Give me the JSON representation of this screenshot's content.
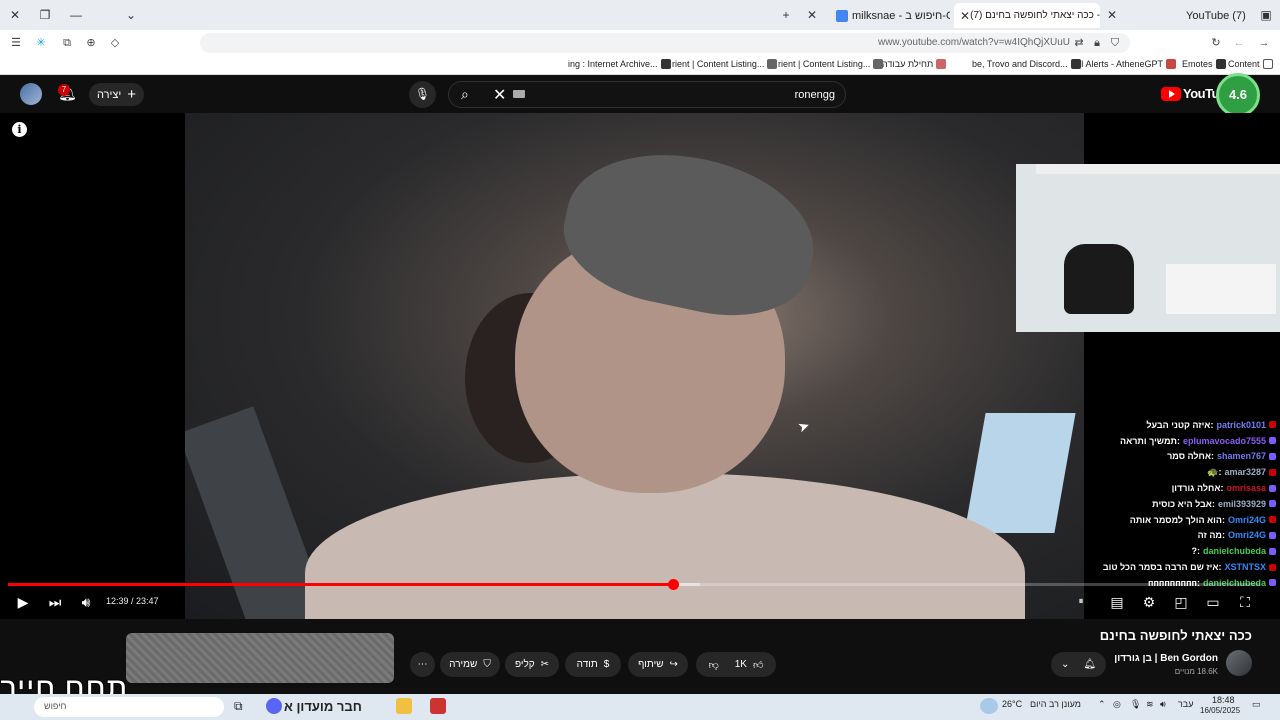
{
  "browser": {
    "tabs": [
      {
        "label": "YouTube (7)",
        "active": false
      },
      {
        "label": "(7) ככה יצאתי לחופשה בחינם - ...",
        "active": true
      },
      {
        "label": "milksnae - חיפוש ב-Google",
        "active": false
      }
    ],
    "url": "www.youtube.com/watch?v=w4IQhQjXUuU",
    "bookmarks": [
      "Content",
      "Emotes",
      "AI Alerts - AtheneGPT",
      "be, Trovo and Discord...",
      "תחילת עבודה",
      "rient | Content Listing...",
      "rient | Content Listing...",
      "ing : Internet Archive..."
    ]
  },
  "youtube": {
    "create_label": "יצירה",
    "notifications": "7",
    "search_value": "ronengg",
    "logo": "YouTube"
  },
  "overlay": {
    "rating": "4.6"
  },
  "player": {
    "current_time": "12:39",
    "duration": "23:47",
    "time_display": "12:39 / 23:47",
    "progress": 0.531,
    "buffered": 0.553
  },
  "chat": [
    {
      "user": "patrick0101",
      "message": "איזה קטני הבעל",
      "color": "#6f7df2"
    },
    {
      "user": "eplumavocado7555",
      "message": "תמשיך ותראה",
      "color": "#8a5cf6"
    },
    {
      "user": "shamen767",
      "message": "אחלה סמר",
      "color": "#6f7df2"
    },
    {
      "user": "amar3287",
      "message": "🐢",
      "color": "#9ab0c0"
    },
    {
      "user": "omrisasa",
      "message": "אחלה גורדון",
      "color": "#cc1122"
    },
    {
      "user": "emil393929",
      "message": "אבל היא כוסית",
      "color": "#9ab0c0"
    },
    {
      "user": "Omri24G",
      "message": "הוא הולך למסמר אותה",
      "color": "#2f8cff"
    },
    {
      "user": "Omri24G",
      "message": "מה זה",
      "color": "#2f8cff"
    },
    {
      "user": "danielchubeda",
      "message": "?",
      "color": "#44cc55"
    },
    {
      "user": "XSTNTSX",
      "message": "איז שם הרבה בסמר הכל טוב",
      "color": "#2f8cff"
    },
    {
      "user": "danielchubeda",
      "message": "ппппппппп",
      "color": "#44cc55"
    }
  ],
  "video": {
    "title": "ככה יצאתי לחופשה בחינם",
    "channel": "Ben Gordon | בן גורדון",
    "subscribers": "18.6K מנויים",
    "like_count": "1K",
    "actions": {
      "share": "שיתוף",
      "thanks": "תודה",
      "clip": "קליפ",
      "save": "שמירה"
    }
  },
  "overlay_text": "תחח חייך",
  "taskbar": {
    "search_placeholder": "חיפוש",
    "app_label": "חבר מועדון א",
    "weather_temp": "26°C",
    "weather_text": "מעונן רב היום",
    "language": "עבר",
    "clock_time": "18:48",
    "clock_date": "16/05/2025"
  },
  "colors": {
    "progress": "#ff0000",
    "brand": "#ff0000",
    "rating_bg": "#2ea043"
  }
}
